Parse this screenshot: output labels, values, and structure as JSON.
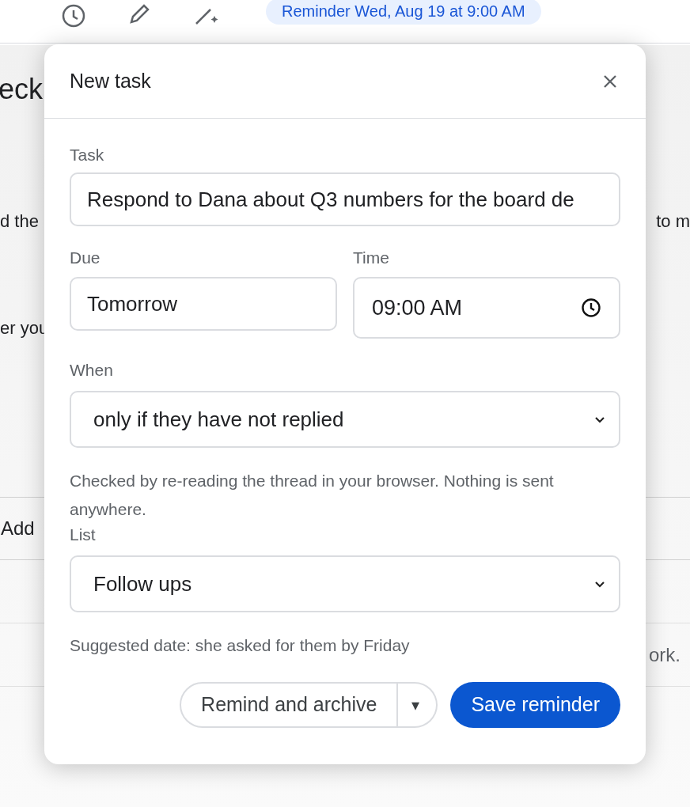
{
  "toolbar": {
    "reminder_chip": "Reminder Wed, Aug 19 at 9:00 AM"
  },
  "background": {
    "heading": "eck",
    "lines": [
      {
        "left": "d the",
        "right": "to m"
      },
      {
        "left": "er you"
      }
    ],
    "add_button": "Add",
    "row_text": "ork."
  },
  "dialog": {
    "title": "New task",
    "task": {
      "label": "Task",
      "value": "Respond to Dana about Q3 numbers for the board de"
    },
    "due": {
      "label": "Due",
      "value": "Tomorrow"
    },
    "time": {
      "label": "Time",
      "value": "09:00 AM"
    },
    "when": {
      "label": "When",
      "value": "only if they have not replied"
    },
    "note": "Checked by re-reading the thread in your browser. Nothing is sent anywhere.",
    "list": {
      "label": "List",
      "value": "Follow ups"
    },
    "suggestion": "Suggested date: she asked for them by Friday",
    "secondary_button": "Remind and archive",
    "dropdown_caret": "▾",
    "primary_button": "Save reminder"
  }
}
